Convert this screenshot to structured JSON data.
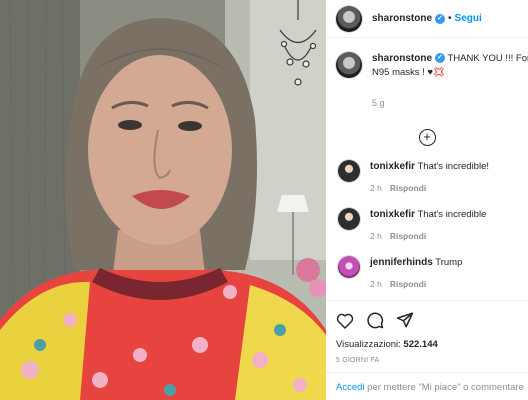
{
  "post": {
    "author": "sharonstone",
    "follow_label": "Segui",
    "separator": "•",
    "caption_text": "THANK YOU !!! For th",
    "caption_line2": "N95 masks ! ♥💢",
    "caption_time": "5 g"
  },
  "comments": [
    {
      "user": "tonixkefir",
      "text": "That's incredible!",
      "time": "2 h",
      "reply": "Rispondi"
    },
    {
      "user": "tonixkefir",
      "text": "That's incredible",
      "time": "2 h",
      "reply": "Rispondi"
    },
    {
      "user": "jenniferhinds",
      "text": "Trump",
      "time": "2 h",
      "reply": "Rispondi"
    }
  ],
  "stats": {
    "views_label": "Visualizzazioni:",
    "views_count": "522.144",
    "time_ago": "5 GIORNI FA"
  },
  "footer": {
    "login_link": "Accedi",
    "rest": " per mettere \"Mi piace\" o commentare"
  },
  "icons": {
    "heart": "heart-icon",
    "comment": "comment-icon",
    "share": "share-icon",
    "verified": "verified-badge-icon",
    "load_more": "plus-circle-icon"
  },
  "colors": {
    "link_blue": "#0095f6",
    "verified_blue": "#3897f0",
    "muted_text": "#8e8e8e"
  }
}
